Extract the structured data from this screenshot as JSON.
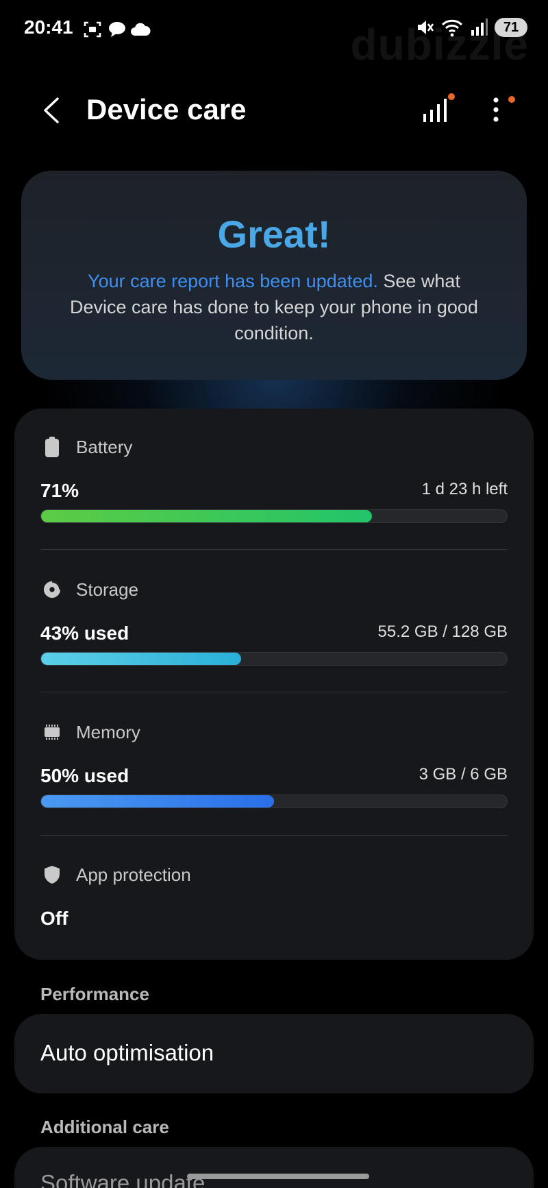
{
  "status_bar": {
    "time": "20:41",
    "battery_level": "71",
    "watermark": "dubizzle",
    "left_icons": [
      "screenshot-icon",
      "chat-bubble-icon",
      "cloud-icon"
    ],
    "right_icons": [
      "mute-icon",
      "wifi-icon",
      "signal-icon",
      "battery-icon"
    ]
  },
  "header": {
    "title": "Device care",
    "icons": [
      "back-arrow-icon",
      "performance-bars-icon",
      "more-options-icon"
    ],
    "badge_color": "#e8662a"
  },
  "report": {
    "title": "Great!",
    "link_text": "Your care report has been updated.",
    "body_text": " See what Device care has done to keep your phone in good condition.",
    "title_color": "#4aa8e6",
    "link_color": "#3e8ff0"
  },
  "status": {
    "battery": {
      "label": "Battery",
      "icon": "battery-icon",
      "value": "71%",
      "detail": "1 d 23 h left",
      "level": 0.71,
      "color": "#3cc85a"
    },
    "storage": {
      "label": "Storage",
      "icon": "pie-chart-icon",
      "value": "43% used",
      "detail": "55.2 GB / 128 GB",
      "level": 0.43,
      "color": "#4ac2e6"
    },
    "memory": {
      "label": "Memory",
      "icon": "memory-chip-icon",
      "value": "50% used",
      "detail": "3 GB / 6 GB",
      "level": 0.5,
      "color": "#3a86f0"
    },
    "app_protection": {
      "label": "App protection",
      "icon": "shield-icon",
      "value": "Off"
    }
  },
  "performance": {
    "group_label": "Performance",
    "item": "Auto optimisation"
  },
  "additional_care": {
    "group_label": "Additional care",
    "item": "Software update"
  }
}
